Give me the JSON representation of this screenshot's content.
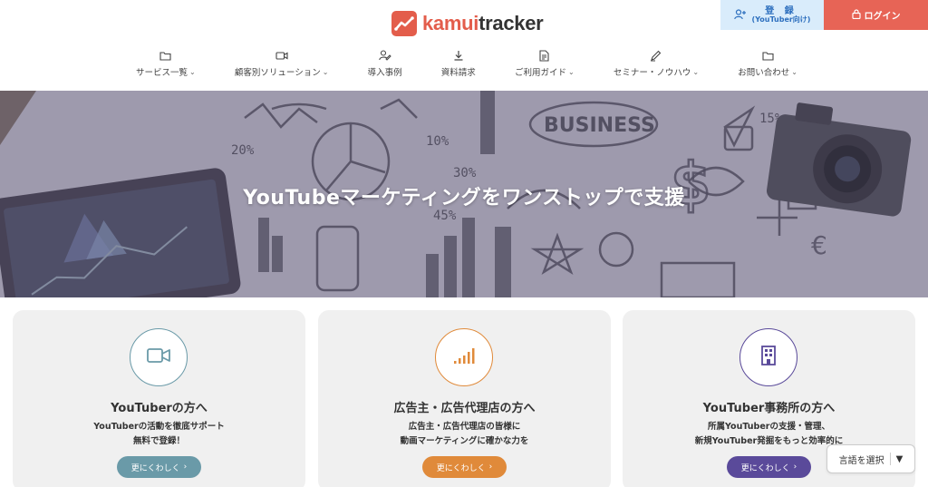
{
  "header": {
    "logo_prefix": "kamui",
    "logo_suffix": "tracker",
    "register_line1": "登 録",
    "register_line2": "(YouTuber向け)",
    "login_label": "ログイン",
    "nav": [
      {
        "label": "サービス一覧",
        "icon": "folder-icon",
        "dropdown": true
      },
      {
        "label": "顧客別ソリューション",
        "icon": "video-camera-icon",
        "dropdown": true
      },
      {
        "label": "導入事例",
        "icon": "user-edit-icon",
        "dropdown": false
      },
      {
        "label": "資料請求",
        "icon": "download-icon",
        "dropdown": false
      },
      {
        "label": "ご利用ガイド",
        "icon": "document-icon",
        "dropdown": true
      },
      {
        "label": "セミナー・ノウハウ",
        "icon": "pen-icon",
        "dropdown": true
      },
      {
        "label": "お問い合わせ",
        "icon": "folder-icon",
        "dropdown": true
      }
    ]
  },
  "hero": {
    "title": "YouTubeマーケティングをワンストップで支援",
    "background_words": [
      "BUSINESS",
      "20%",
      "10%",
      "30%",
      "45%",
      "15%"
    ]
  },
  "cards": [
    {
      "title": "YouTuberの方へ",
      "desc_line1": "YouTuberの活動を徹底サポート",
      "desc_line2": "無料で登録！",
      "more_label": "更にくわしく",
      "icon": "video-camera-icon",
      "accent": "#6a9aa8"
    },
    {
      "title": "広告主・広告代理店の方へ",
      "desc_line1": "広告主・広告代理店の皆様に",
      "desc_line2": "動画マーケティングに確かな力を",
      "more_label": "更にくわしく",
      "icon": "bar-signal-icon",
      "accent": "#e08a3a"
    },
    {
      "title": "YouTuber事務所の方へ",
      "desc_line1": "所属YouTuberの支援・管理、",
      "desc_line2": "新規YouTuber発掘をもっと効率的に",
      "more_label": "更にくわしく",
      "icon": "building-icon",
      "accent": "#5a4a9a"
    }
  ],
  "language": {
    "label": "言語を選択",
    "arrow": "▼"
  },
  "colors": {
    "brand": "#e35d4b",
    "register_bg": "#d9ecfb",
    "login_bg": "#e76456"
  }
}
